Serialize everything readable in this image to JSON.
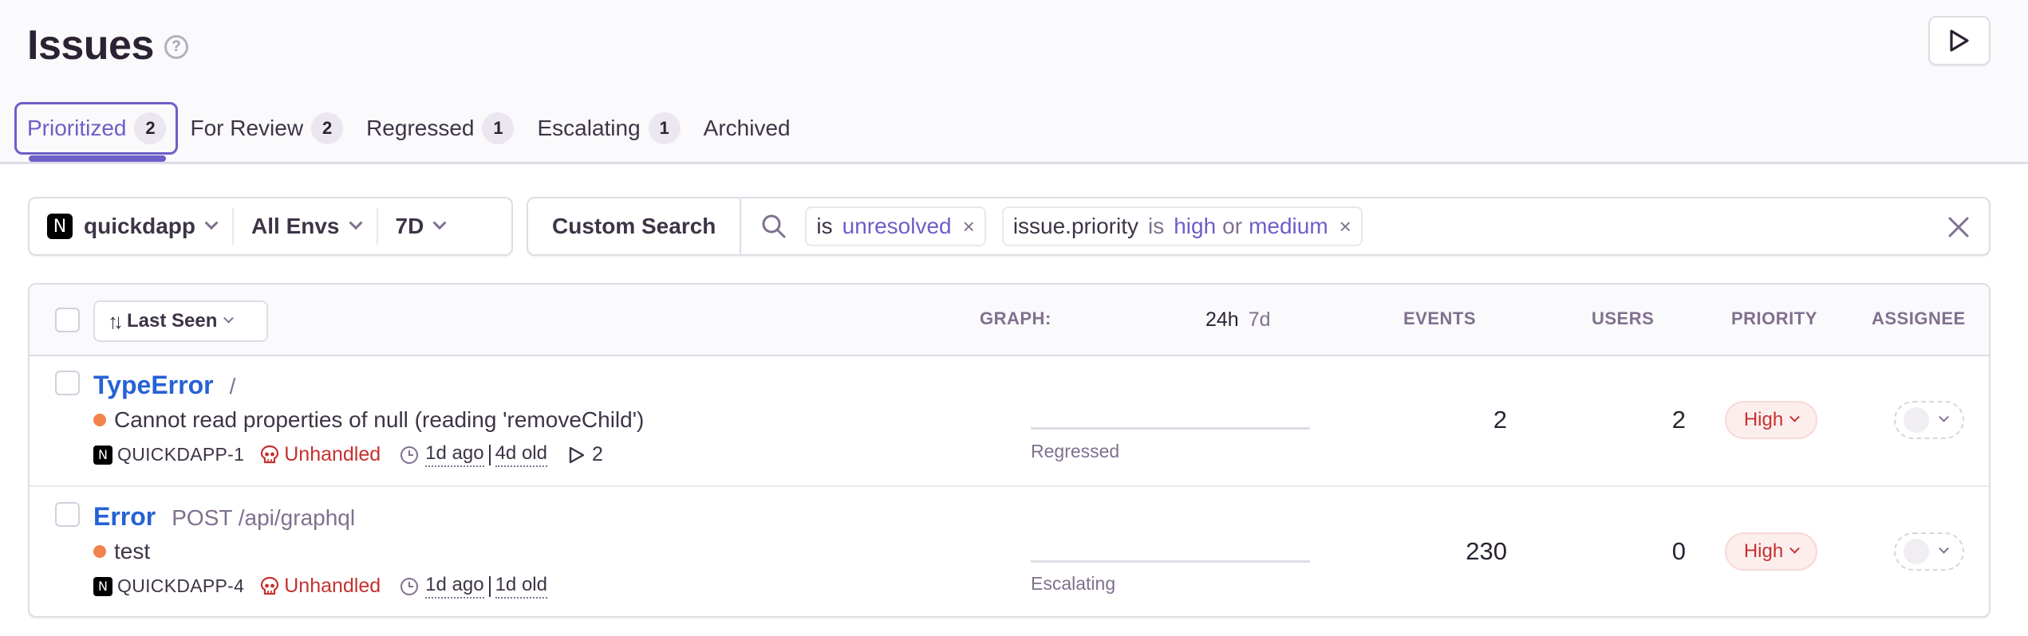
{
  "header": {
    "title": "Issues",
    "help_icon": "question-circle-icon",
    "play_icon": "play-icon"
  },
  "tabs": [
    {
      "label": "Prioritized",
      "count": "2",
      "active": true
    },
    {
      "label": "For Review",
      "count": "2",
      "active": false
    },
    {
      "label": "Regressed",
      "count": "1",
      "active": false
    },
    {
      "label": "Escalating",
      "count": "1",
      "active": false
    },
    {
      "label": "Archived",
      "count": null,
      "active": false
    }
  ],
  "filters": {
    "project": "quickdapp",
    "project_icon": "N",
    "environment": "All Envs",
    "date_range": "7D"
  },
  "search": {
    "saved_search_label": "Custom Search",
    "tokens": [
      {
        "key": "",
        "op": "is",
        "values": [
          "unresolved"
        ],
        "conjunction": ""
      },
      {
        "key": "issue.priority",
        "op": "is",
        "values": [
          "high",
          "medium"
        ],
        "conjunction": "or"
      }
    ],
    "token1": {
      "op": "is",
      "value": "unresolved"
    },
    "token2": {
      "key": "issue.priority",
      "op": "is",
      "value1": "high",
      "conj": "or",
      "value2": "medium"
    },
    "remove_glyph": "×"
  },
  "table": {
    "sort_label": "Last Seen",
    "columns": {
      "graph": "GRAPH:",
      "graph_24h": "24h",
      "graph_7d": "7d",
      "events": "EVENTS",
      "users": "USERS",
      "priority": "PRIORITY",
      "assignee": "ASSIGNEE"
    },
    "rows": [
      {
        "type": "TypeError",
        "location": "/",
        "message": "Cannot read properties of null (reading 'removeChild')",
        "project_icon": "N",
        "short_id": "QUICKDAPP-1",
        "mechanism": "Unhandled",
        "last_seen": "1d ago",
        "age": "4d old",
        "replays": "2",
        "graph_label": "Regressed",
        "events": "2",
        "users": "2",
        "priority": "High"
      },
      {
        "type": "Error",
        "location": "POST /api/graphql",
        "message": "test",
        "project_icon": "N",
        "short_id": "QUICKDAPP-4",
        "mechanism": "Unhandled",
        "last_seen": "1d ago",
        "age": "1d old",
        "replays": null,
        "graph_label": "Escalating",
        "events": "230",
        "users": "0",
        "priority": "High"
      }
    ]
  },
  "colors": {
    "accent": "#6c5fc7",
    "link": "#2562d4",
    "error": "#c6312f",
    "level_dot": "#f1834c",
    "muted": "#80708f"
  }
}
